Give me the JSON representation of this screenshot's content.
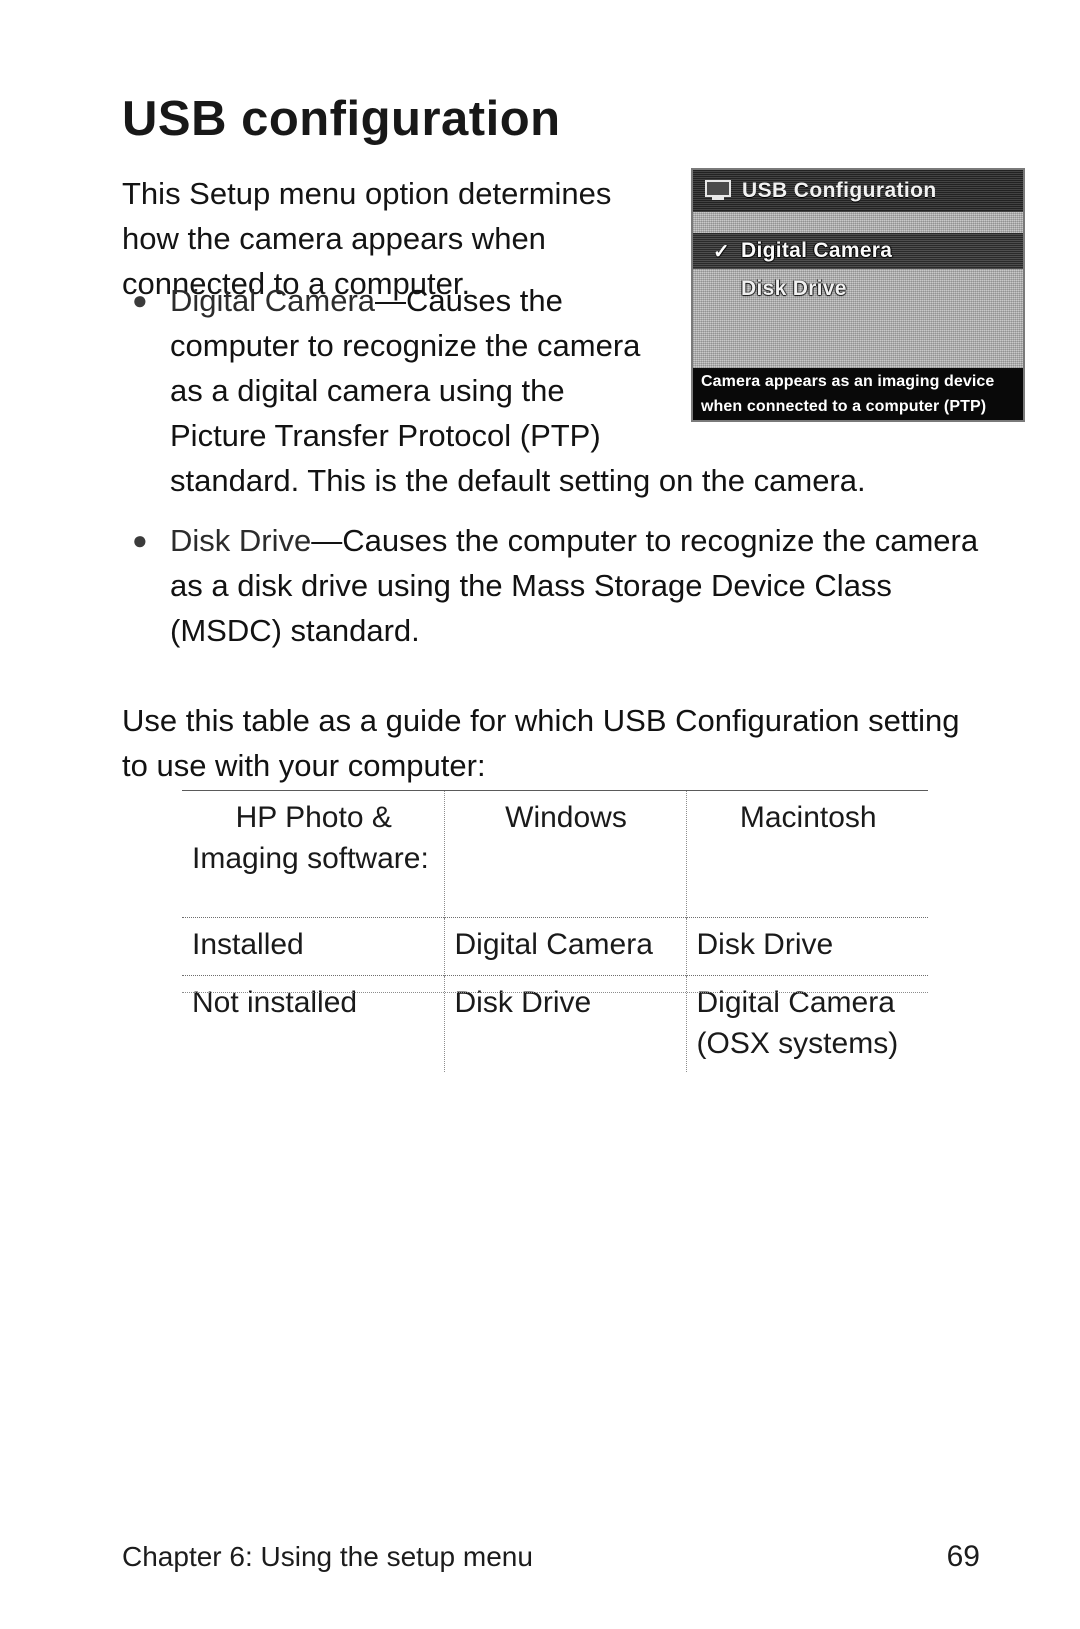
{
  "page": {
    "title": "USB configuration",
    "intro_paragraph": "This Setup menu option determines how the camera appears when connected to a computer.",
    "table_intro": "Use this table as a guide for which USB Configuration setting to use with your computer:"
  },
  "bullets": [
    {
      "marker": "●",
      "term": "Digital Camera",
      "dash": "—",
      "text_head": "Causes the computer to recognize the camera as a digital camera using the Picture Transfer Protocol (PTP)",
      "text_tail": "standard. This is the default setting on the camera."
    },
    {
      "marker": "●",
      "term": "Disk Drive",
      "dash": "—",
      "text_head": "Causes the computer to recognize the camera as a disk drive using the Mass Storage Device Class (MSDC) standard.",
      "text_tail": ""
    }
  ],
  "lcd_figure": {
    "title": "USB Configuration",
    "title_icon": "monitor-icon",
    "options": [
      {
        "label": "Digital Camera",
        "check": "✓",
        "selected": true
      },
      {
        "label": "Disk Drive",
        "check": "",
        "selected": false
      }
    ],
    "caption_line_1": "Camera appears as an imaging device",
    "caption_line_2": "when connected to a computer (PTP)",
    "colors": {
      "screen_background": "#bdbdbd",
      "title_bar": "#2e2e2e",
      "selection_bar": "#3a3a3a",
      "caption_background": "#090909",
      "caption_text": "#ffffff"
    }
  },
  "table": {
    "headers": [
      {
        "line_1": "HP Photo &",
        "line_2": "Imaging software:"
      },
      {
        "line_1": "Windows",
        "line_2": ""
      },
      {
        "line_1": "Macintosh",
        "line_2": ""
      }
    ],
    "rows": [
      {
        "label": "Installed",
        "windows": "Digital Camera",
        "macintosh": "Disk Drive",
        "macintosh_note": ""
      },
      {
        "label": "Not installed",
        "windows": "Disk Drive",
        "macintosh": "Digital Camera",
        "macintosh_note": "(OSX systems)"
      }
    ]
  },
  "footer": {
    "chapter_text": "Chapter 6: Using the setup menu",
    "page_number": "69"
  }
}
